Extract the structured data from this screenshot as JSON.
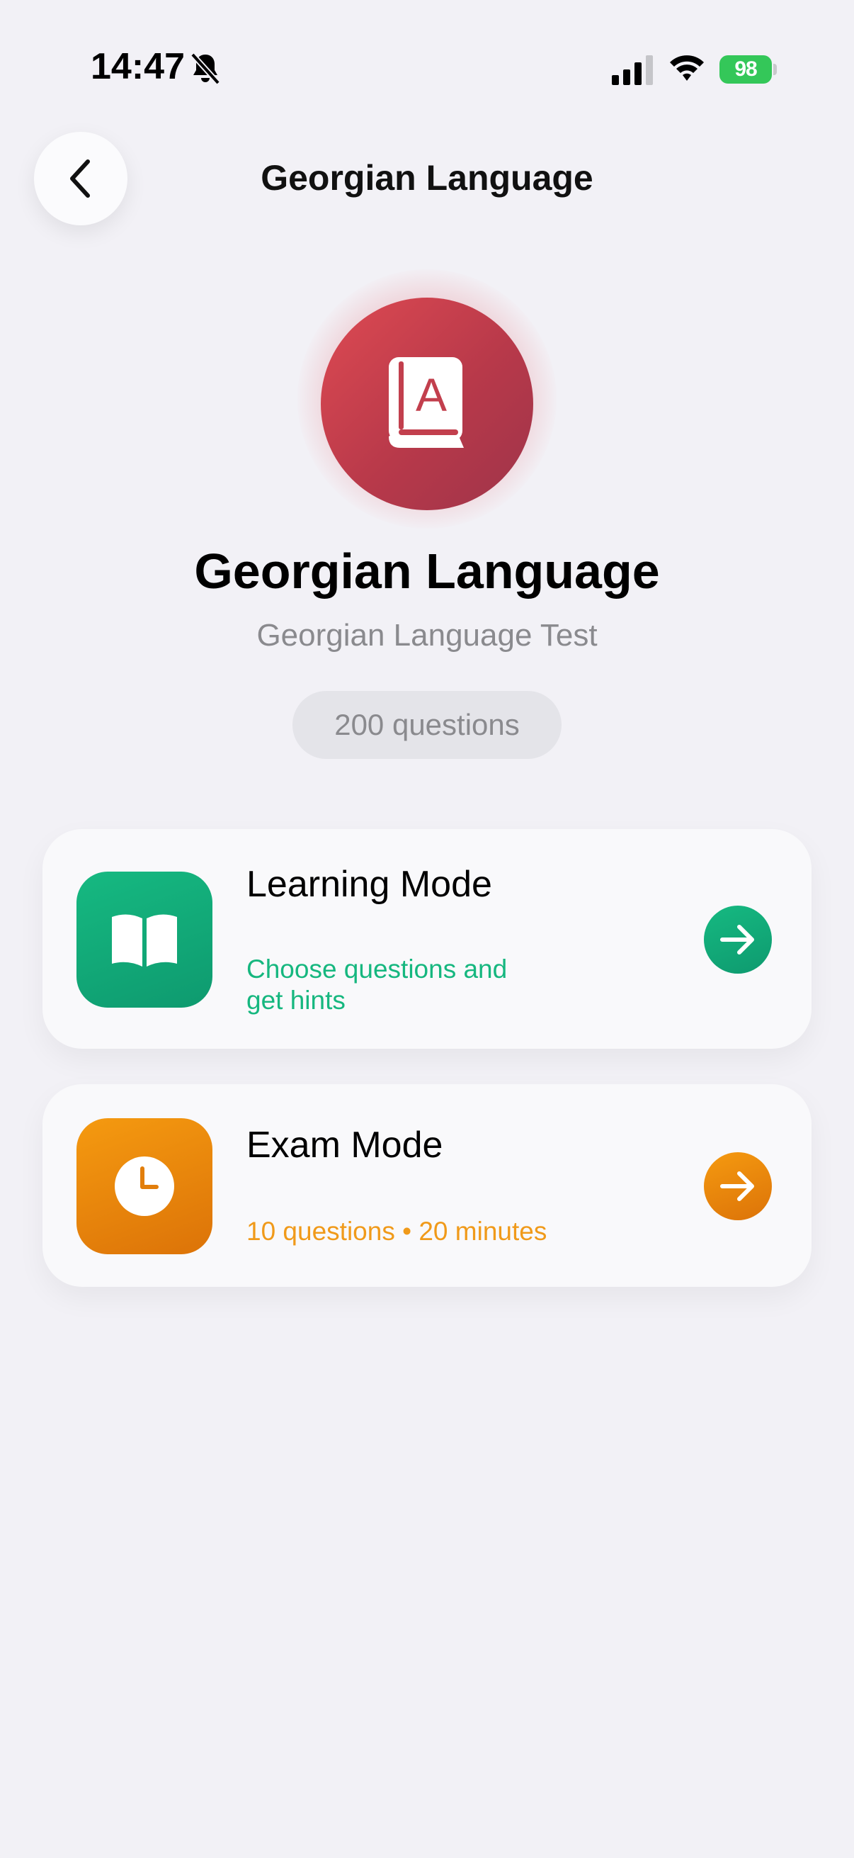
{
  "status_bar": {
    "time": "14:47",
    "battery_level": "98",
    "icons": [
      "bell-slash-icon",
      "cellular-signal-icon",
      "wifi-icon",
      "battery-charging-icon"
    ]
  },
  "nav": {
    "title": "Georgian Language",
    "back_icon": "chevron-left-icon"
  },
  "hero": {
    "icon": "book-letter-a-icon",
    "title": "Georgian Language",
    "subtitle": "Georgian Language Test",
    "question_count": "200 questions"
  },
  "modes": [
    {
      "title": "Learning Mode",
      "description": "Choose questions and get hints",
      "icon": "open-book-icon",
      "accent": "#16b77f"
    },
    {
      "title": "Exam Mode",
      "description": "10 questions • 20 minutes",
      "icon": "clock-icon",
      "accent": "#f09a1a"
    }
  ],
  "colors": {
    "background": "#f2f1f6",
    "hero_red": "#c83f4c",
    "learning_green": "#16b77f",
    "exam_orange": "#f09a1a",
    "battery_green": "#34c759"
  }
}
